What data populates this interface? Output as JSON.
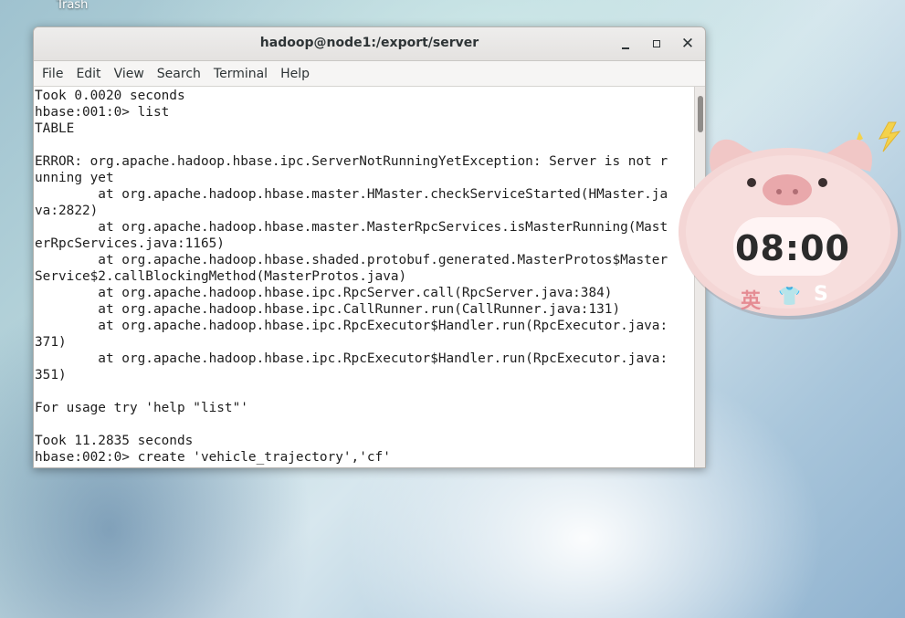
{
  "desktop": {
    "trash_label": "Trash"
  },
  "window": {
    "title": "hadoop@node1:/export/server",
    "menu": [
      "File",
      "Edit",
      "View",
      "Search",
      "Terminal",
      "Help"
    ]
  },
  "terminal": {
    "lines": [
      "Took 0.0020 seconds",
      "hbase:001:0> list",
      "TABLE",
      "",
      "ERROR: org.apache.hadoop.hbase.ipc.ServerNotRunningYetException: Server is not r",
      "unning yet",
      "        at org.apache.hadoop.hbase.master.HMaster.checkServiceStarted(HMaster.ja",
      "va:2822)",
      "        at org.apache.hadoop.hbase.master.MasterRpcServices.isMasterRunning(Mast",
      "erRpcServices.java:1165)",
      "        at org.apache.hadoop.hbase.shaded.protobuf.generated.MasterProtos$Master",
      "Service$2.callBlockingMethod(MasterProtos.java)",
      "        at org.apache.hadoop.hbase.ipc.RpcServer.call(RpcServer.java:384)",
      "        at org.apache.hadoop.hbase.ipc.CallRunner.run(CallRunner.java:131)",
      "        at org.apache.hadoop.hbase.ipc.RpcExecutor$Handler.run(RpcExecutor.java:",
      "371)",
      "        at org.apache.hadoop.hbase.ipc.RpcExecutor$Handler.run(RpcExecutor.java:",
      "351)",
      "",
      "For usage try 'help \"list\"'",
      "",
      "Took 11.2835 seconds",
      "hbase:002:0> create 'vehicle_trajectory','cf'"
    ]
  },
  "widget": {
    "time": "08:00",
    "ime_label": "英",
    "s_label": "S"
  }
}
